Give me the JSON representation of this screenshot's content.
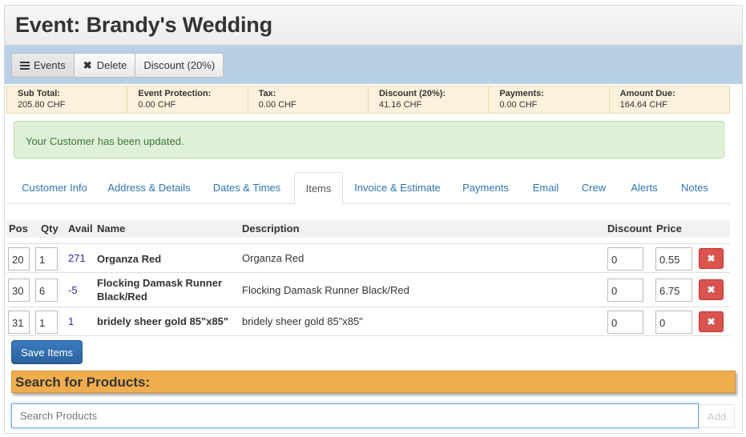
{
  "title": "Event: Brandy's Wedding",
  "toolbar": {
    "events_label": "Events",
    "delete_label": "Delete",
    "discount_label": "Discount (20%)"
  },
  "summary": [
    {
      "label": "Sub Total:",
      "value": "205.80 CHF"
    },
    {
      "label": "Event Protection:",
      "value": "0.00 CHF"
    },
    {
      "label": "Tax:",
      "value": "0.00 CHF"
    },
    {
      "label": "Discount (20%):",
      "value": "41.16 CHF"
    },
    {
      "label": "Payments:",
      "value": "0.00 CHF"
    },
    {
      "label": "Amount Due:",
      "value": "164.64 CHF"
    }
  ],
  "alert": "Your Customer has been updated.",
  "tabs": [
    {
      "label": "Customer Info"
    },
    {
      "label": "Address & Details"
    },
    {
      "label": "Dates & Times"
    },
    {
      "label": "Items",
      "active": true
    },
    {
      "label": "Invoice & Estimate"
    },
    {
      "label": "Payments"
    },
    {
      "label": "Email"
    },
    {
      "label": "Crew"
    },
    {
      "label": "Alerts"
    },
    {
      "label": "Notes"
    }
  ],
  "table": {
    "headers": {
      "pos": "Pos",
      "qty": "Qty",
      "avail": "Avail",
      "name": "Name",
      "description": "Description",
      "discount": "Discount",
      "price": "Price"
    },
    "rows": [
      {
        "pos": "20",
        "qty": "1",
        "avail": "271",
        "name": "Organza Red",
        "description": "Organza Red",
        "discount": "0",
        "price": "0.55"
      },
      {
        "pos": "30",
        "qty": "6",
        "avail": "-5",
        "name": "Flocking Damask Runner Black/Red",
        "description": "Flocking Damask Runner Black/Red",
        "discount": "0",
        "price": "6.75"
      },
      {
        "pos": "31",
        "qty": "1",
        "avail": "1",
        "name": "bridely sheer gold 85\"x85\"",
        "description": "bridely sheer gold 85\"x85\"",
        "discount": "0",
        "price": "0"
      }
    ]
  },
  "save_label": "Save Items",
  "search": {
    "header": "Search for Products:",
    "placeholder": "Search Products",
    "add_label": "Add"
  },
  "colors": {
    "toolbar_bg": "#b8d0e6",
    "summary_bg": "#fcf1dc",
    "alert_bg": "#dff0d8",
    "link": "#2f74b5",
    "danger": "#d9534f",
    "primary": "#2a629e",
    "search_header": "#f0ad4e"
  },
  "icons": {
    "events": "list-icon",
    "delete": "close-icon",
    "row_delete": "close-icon"
  }
}
